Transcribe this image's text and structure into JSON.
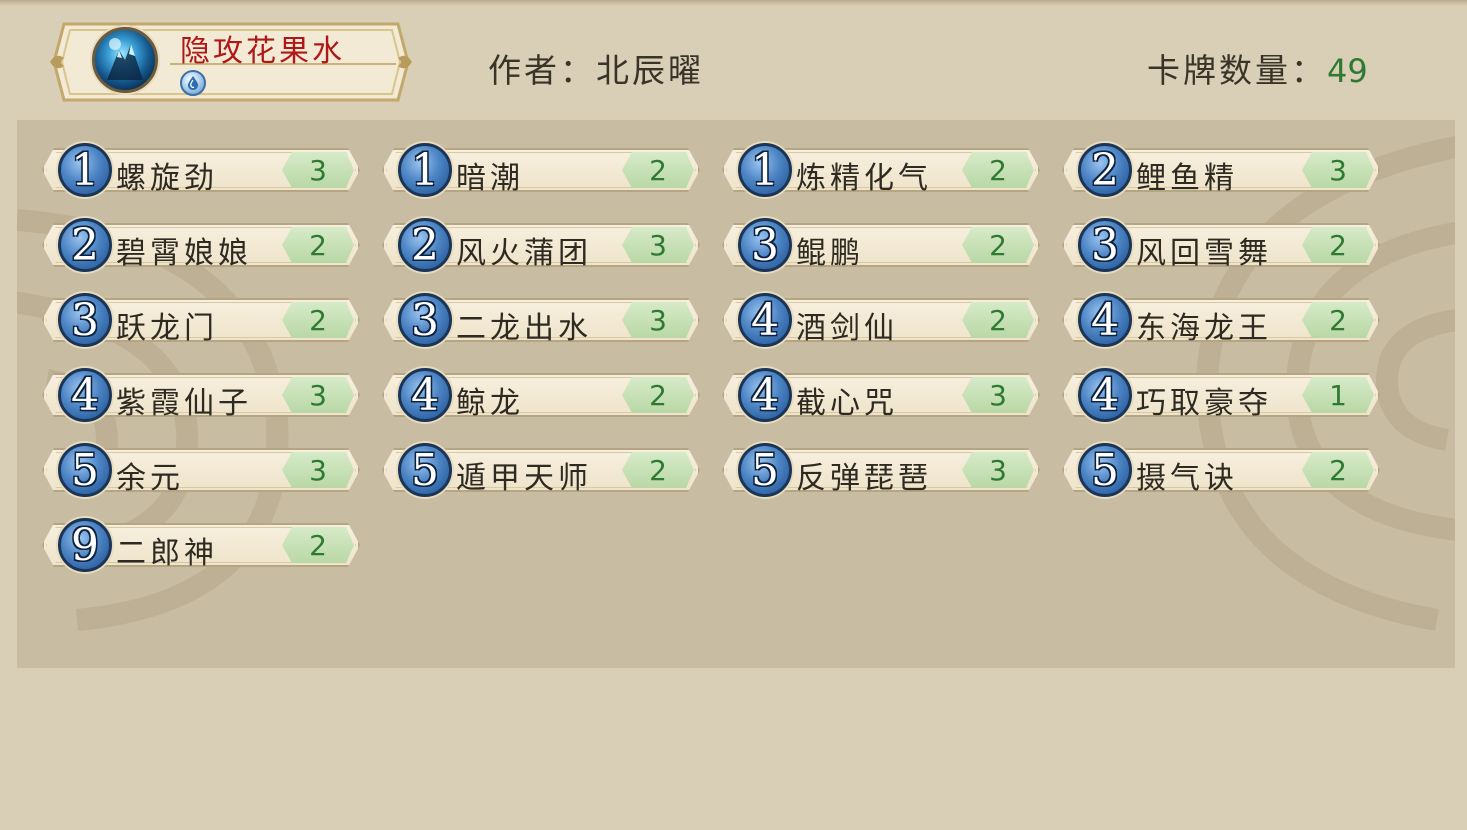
{
  "deck": {
    "name": "隐攻花果水",
    "author_label": "作者：",
    "author": "北辰曜",
    "card_count_label": "卡牌数量：",
    "card_count": "49",
    "element_icon": "water-drop-icon",
    "avatar_icon": "ice-mountain-avatar-icon"
  },
  "colors": {
    "deck_name": "#b01818",
    "count_text": "#2f7a32",
    "cost_orb": "#4c84c4",
    "background": "#d9ceb6"
  },
  "cards": [
    {
      "cost": "1",
      "name": "螺旋劲",
      "count": "3"
    },
    {
      "cost": "1",
      "name": "暗潮",
      "count": "2"
    },
    {
      "cost": "1",
      "name": "炼精化气",
      "count": "2"
    },
    {
      "cost": "2",
      "name": "鲤鱼精",
      "count": "3"
    },
    {
      "cost": "2",
      "name": "碧霄娘娘",
      "count": "2"
    },
    {
      "cost": "2",
      "name": "风火蒲团",
      "count": "3"
    },
    {
      "cost": "3",
      "name": "鲲鹏",
      "count": "2"
    },
    {
      "cost": "3",
      "name": "风回雪舞",
      "count": "2"
    },
    {
      "cost": "3",
      "name": "跃龙门",
      "count": "2"
    },
    {
      "cost": "3",
      "name": "二龙出水",
      "count": "3"
    },
    {
      "cost": "4",
      "name": "酒剑仙",
      "count": "2"
    },
    {
      "cost": "4",
      "name": "东海龙王",
      "count": "2"
    },
    {
      "cost": "4",
      "name": "紫霞仙子",
      "count": "3"
    },
    {
      "cost": "4",
      "name": "鲸龙",
      "count": "2"
    },
    {
      "cost": "4",
      "name": "截心咒",
      "count": "3"
    },
    {
      "cost": "4",
      "name": "巧取豪夺",
      "count": "1"
    },
    {
      "cost": "5",
      "name": "余元",
      "count": "3"
    },
    {
      "cost": "5",
      "name": "遁甲天师",
      "count": "2"
    },
    {
      "cost": "5",
      "name": "反弹琵琶",
      "count": "3"
    },
    {
      "cost": "5",
      "name": "摄气诀",
      "count": "2"
    },
    {
      "cost": "9",
      "name": "二郎神",
      "count": "2"
    }
  ]
}
